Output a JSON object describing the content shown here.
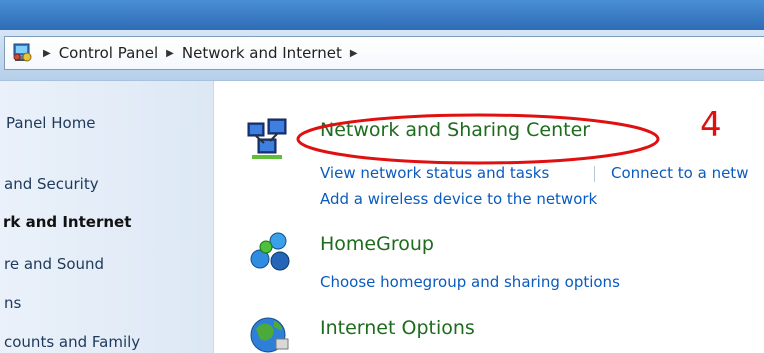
{
  "breadcrumb": {
    "items": [
      "Control Panel",
      "Network and Internet"
    ]
  },
  "sidebar": {
    "items": [
      {
        "label": "Panel Home",
        "bold": false
      },
      {
        "label": "and Security",
        "bold": false
      },
      {
        "label": "rk and Internet",
        "bold": true
      },
      {
        "label": "re and Sound",
        "bold": false
      },
      {
        "label": "ns",
        "bold": false
      },
      {
        "label": "counts and Family",
        "bold": false
      }
    ]
  },
  "categories": [
    {
      "title": "Network and Sharing Center",
      "links": [
        "View network status and tasks",
        "Connect to a netw",
        "Add a wireless device to the network"
      ]
    },
    {
      "title": "HomeGroup",
      "links": [
        "Choose homegroup and sharing options"
      ]
    },
    {
      "title": "Internet Options",
      "links": []
    }
  ],
  "annotation": {
    "number": "4",
    "color": "#e01010"
  },
  "colors": {
    "title_green": "#1e6b1e",
    "link_blue": "#0b5bbf",
    "sidebar_bg": "#dde8f5"
  }
}
